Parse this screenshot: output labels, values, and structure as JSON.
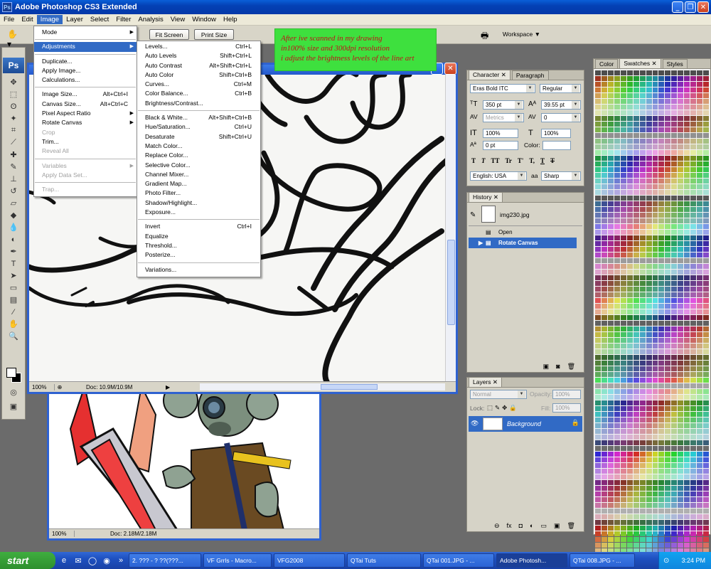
{
  "app": {
    "title": "Adobe Photoshop CS3 Extended",
    "logo": "Ps"
  },
  "menubar": [
    "File",
    "Edit",
    "Image",
    "Layer",
    "Select",
    "Filter",
    "Analysis",
    "View",
    "Window",
    "Help"
  ],
  "options": {
    "fit_screen": "Fit Screen",
    "print_size": "Print Size",
    "workspace": "Workspace"
  },
  "annotation": {
    "lines": [
      "After ive scanned in my drawing",
      "in100% size and 300dpi resolution",
      "i adjust the brightness levels of the line art"
    ],
    "color": "#c0101a",
    "background": "#3ee03e"
  },
  "image_menu": [
    {
      "label": "Mode",
      "shortcut": "",
      "submenu": true,
      "disabled": false
    },
    {
      "sep": true
    },
    {
      "label": "Adjustments",
      "shortcut": "",
      "submenu": true,
      "disabled": false,
      "highlight": true
    },
    {
      "sep": true
    },
    {
      "label": "Duplicate...",
      "shortcut": "",
      "submenu": false,
      "disabled": false
    },
    {
      "label": "Apply Image...",
      "shortcut": "",
      "submenu": false,
      "disabled": false
    },
    {
      "label": "Calculations...",
      "shortcut": "",
      "submenu": false,
      "disabled": false
    },
    {
      "sep": true
    },
    {
      "label": "Image Size...",
      "shortcut": "Alt+Ctrl+I",
      "submenu": false,
      "disabled": false
    },
    {
      "label": "Canvas Size...",
      "shortcut": "Alt+Ctrl+C",
      "submenu": false,
      "disabled": false
    },
    {
      "label": "Pixel Aspect Ratio",
      "shortcut": "",
      "submenu": true,
      "disabled": false
    },
    {
      "label": "Rotate Canvas",
      "shortcut": "",
      "submenu": true,
      "disabled": false
    },
    {
      "label": "Crop",
      "shortcut": "",
      "submenu": false,
      "disabled": true
    },
    {
      "label": "Trim...",
      "shortcut": "",
      "submenu": false,
      "disabled": false
    },
    {
      "label": "Reveal All",
      "shortcut": "",
      "submenu": false,
      "disabled": true
    },
    {
      "sep": true
    },
    {
      "label": "Variables",
      "shortcut": "",
      "submenu": true,
      "disabled": true
    },
    {
      "label": "Apply Data Set...",
      "shortcut": "",
      "submenu": false,
      "disabled": true
    },
    {
      "sep": true
    },
    {
      "label": "Trap...",
      "shortcut": "",
      "submenu": false,
      "disabled": true
    }
  ],
  "adjust_menu": [
    {
      "label": "Levels...",
      "shortcut": "Ctrl+L"
    },
    {
      "label": "Auto Levels",
      "shortcut": "Shift+Ctrl+L"
    },
    {
      "label": "Auto Contrast",
      "shortcut": "Alt+Shift+Ctrl+L"
    },
    {
      "label": "Auto Color",
      "shortcut": "Shift+Ctrl+B"
    },
    {
      "label": "Curves...",
      "shortcut": "Ctrl+M"
    },
    {
      "label": "Color Balance...",
      "shortcut": "Ctrl+B"
    },
    {
      "label": "Brightness/Contrast...",
      "shortcut": ""
    },
    {
      "sep": true
    },
    {
      "label": "Black & White...",
      "shortcut": "Alt+Shift+Ctrl+B"
    },
    {
      "label": "Hue/Saturation...",
      "shortcut": "Ctrl+U"
    },
    {
      "label": "Desaturate",
      "shortcut": "Shift+Ctrl+U"
    },
    {
      "label": "Match Color...",
      "shortcut": ""
    },
    {
      "label": "Replace Color...",
      "shortcut": ""
    },
    {
      "label": "Selective Color...",
      "shortcut": ""
    },
    {
      "label": "Channel Mixer...",
      "shortcut": ""
    },
    {
      "label": "Gradient Map...",
      "shortcut": ""
    },
    {
      "label": "Photo Filter...",
      "shortcut": ""
    },
    {
      "label": "Shadow/Highlight...",
      "shortcut": ""
    },
    {
      "label": "Exposure...",
      "shortcut": ""
    },
    {
      "sep": true
    },
    {
      "label": "Invert",
      "shortcut": "Ctrl+I"
    },
    {
      "label": "Equalize",
      "shortcut": ""
    },
    {
      "label": "Threshold...",
      "shortcut": ""
    },
    {
      "label": "Posterize...",
      "shortcut": ""
    },
    {
      "sep": true
    },
    {
      "label": "Variations...",
      "shortcut": ""
    }
  ],
  "doc1": {
    "zoom": "100%",
    "doc": "Doc: 10.9M/10.9M"
  },
  "doc2": {
    "zoom": "100%",
    "doc": "Doc: 2.18M/2.18M"
  },
  "character": {
    "tabs": [
      "Character",
      "Paragraph"
    ],
    "font_family": "Eras Bold ITC",
    "font_style": "Regular",
    "size": "350 pt",
    "leading": "39.55 pt",
    "kerning": "Metrics",
    "tracking": "0",
    "vscale": "100%",
    "hscale": "100%",
    "baseline": "0 pt",
    "color_label": "Color:",
    "language": "English: USA",
    "aa_label": "aa",
    "antialias": "Sharp",
    "styles": [
      "T",
      "T",
      "TT",
      "Tr",
      "T'",
      "T,",
      "T",
      "T"
    ]
  },
  "history": {
    "tab": "History",
    "snapshot": "img230.jpg",
    "items": [
      "Open",
      "Rotate Canvas"
    ]
  },
  "layers": {
    "tab": "Layers",
    "blend": "Normal",
    "opacity_label": "Opacity:",
    "opacity": "100%",
    "lock_label": "Lock:",
    "fill_label": "Fill:",
    "fill": "100%",
    "layer": "Background"
  },
  "swatches": {
    "tabs": [
      "Color",
      "Swatches",
      "Styles"
    ]
  },
  "taskbar": {
    "start": "start",
    "tasks": [
      "2. ??? - ? ??(???...",
      "VF Grrls - Macro...",
      "VFG2008",
      "QTai Tuts",
      "QTai 001.JPG - ...",
      "Adobe Photosh...",
      "QTai 008.JPG - ..."
    ],
    "time": "3:24 PM"
  }
}
